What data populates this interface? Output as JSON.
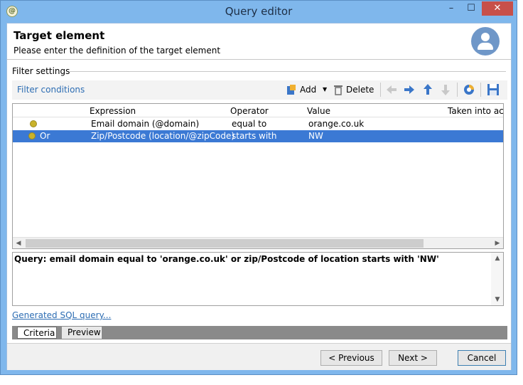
{
  "window": {
    "title": "Query editor",
    "minimize": "–",
    "maximize": "☐",
    "close": "✕"
  },
  "header": {
    "title": "Target element",
    "subtitle": "Please enter the definition of the target element"
  },
  "filter_settings": {
    "label": "Filter settings"
  },
  "toolbar": {
    "label": "Filter conditions",
    "add_label": "Add",
    "delete_label": "Delete"
  },
  "grid": {
    "columns": [
      "Expression",
      "Operator",
      "Value",
      "Taken into acco"
    ],
    "rows": [
      {
        "prefix": "",
        "expression": "Email domain (@domain)",
        "operator": "equal to",
        "value": "orange.co.uk",
        "selected": false
      },
      {
        "prefix": "Or",
        "expression": "Zip/Postcode (location/@zipCode)",
        "operator": "starts with",
        "value": "NW",
        "selected": true
      }
    ]
  },
  "query": {
    "text": "Query: email domain equal to 'orange.co.uk' or zip/Postcode of location starts with 'NW'"
  },
  "sql_link": "Generated SQL query...",
  "tabs": [
    {
      "label": "Criteria",
      "active": true
    },
    {
      "label": "Preview",
      "active": false
    }
  ],
  "footer": {
    "previous_label": "< Previous",
    "next_label": "Next >",
    "cancel_label": "Cancel"
  },
  "colors": {
    "title_bar": "#7fb7ec",
    "selection": "#3b79d4",
    "link": "#2d6db3",
    "close_button": "#c7504a"
  }
}
